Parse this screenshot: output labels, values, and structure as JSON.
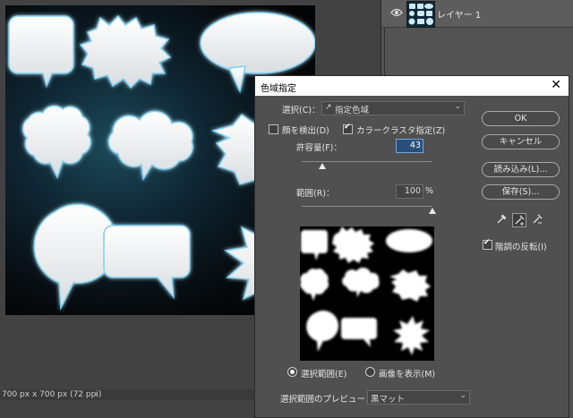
{
  "status_bar": {
    "doc_size": "700 px x 700 px (72 ppi)"
  },
  "layers": {
    "items": [
      {
        "name": "レイヤー 1",
        "visible": true
      }
    ]
  },
  "dialog": {
    "title": "色域指定",
    "close_glyph": "✕",
    "select_label": "選択(C)：",
    "select_value": "指定色域",
    "detect_faces_label": "顔を検出(D)",
    "detect_faces_checked": false,
    "localized_clusters_label": "カラークラスタ指定(Z)",
    "localized_clusters_checked": true,
    "fuzziness_label": "許容量(F)：",
    "fuzziness_value": "43",
    "fuzziness_fraction": 0.16,
    "range_label": "範囲(R)：",
    "range_value": "100",
    "range_unit": "%",
    "range_fraction": 1.0,
    "radio_selection_label": "選択範囲(E)",
    "radio_image_label": "画像を表示(M)",
    "radio_selected": "selection",
    "preview_label": "選択範囲のプレビュー：",
    "preview_value": "黒マット",
    "buttons": {
      "ok": "OK",
      "cancel": "キャンセル",
      "load": "読み込み(L)...",
      "save": "保存(S)..."
    },
    "invert_label": "階調の反転(I)",
    "invert_checked": true
  }
}
